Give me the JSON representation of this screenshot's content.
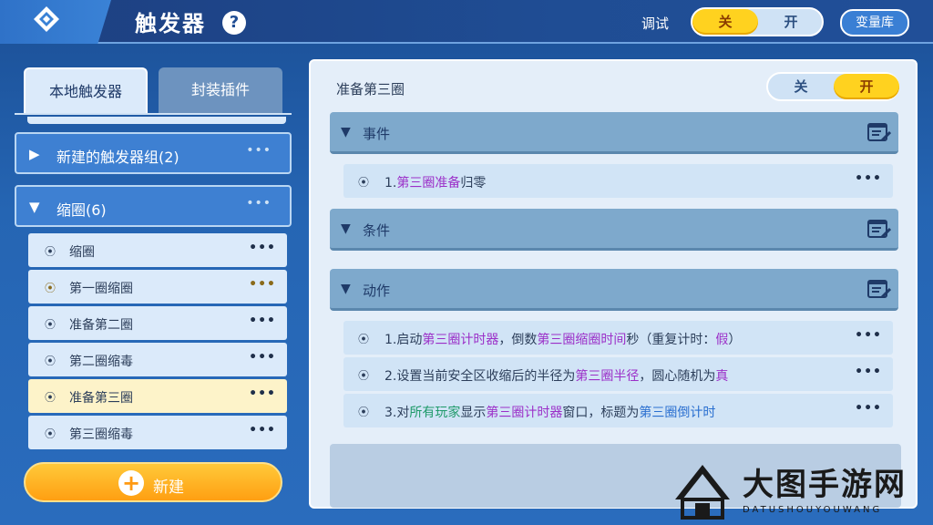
{
  "header": {
    "title": "触发器",
    "help_symbol": "?",
    "debug_label": "调试",
    "debug_toggle": {
      "off": "关",
      "on": "开",
      "selected": "off"
    },
    "var_lib_button": "变量库"
  },
  "left": {
    "tabs": [
      {
        "label": "本地触发器",
        "active": true
      },
      {
        "label": "封装插件",
        "active": false
      }
    ],
    "groups": [
      {
        "label": "新建的触发器组(2)",
        "expanded": false,
        "more": "•••"
      },
      {
        "label": "缩圈(6)",
        "expanded": true,
        "more": "•••"
      }
    ],
    "items": [
      {
        "label": "缩圈",
        "more": "•••"
      },
      {
        "label": "第一圈缩圈",
        "more": "•••"
      },
      {
        "label": "准备第二圈",
        "more": "•••"
      },
      {
        "label": "第二圈缩毒",
        "more": "•••"
      },
      {
        "label": "准备第三圈",
        "more": "•••",
        "selected": true
      },
      {
        "label": "第三圈缩毒",
        "more": "•••"
      }
    ],
    "new_button": {
      "icon": "+",
      "label": "新建"
    }
  },
  "right": {
    "trigger_title": "准备第三圈",
    "toggle": {
      "off": "关",
      "on": "开",
      "selected": "on"
    },
    "sections": [
      {
        "label": "事件"
      },
      {
        "label": "条件"
      },
      {
        "label": "动作"
      }
    ],
    "event_rows": [
      {
        "parts": [
          {
            "t": "1.",
            "c": ""
          },
          {
            "t": "第三圈准备",
            "c": "purple"
          },
          {
            "t": "归零",
            "c": ""
          }
        ],
        "more": "•••"
      }
    ],
    "action_rows": [
      {
        "parts": [
          {
            "t": "1.启动",
            "c": ""
          },
          {
            "t": "第三圈计时器",
            "c": "purple"
          },
          {
            "t": "，倒数",
            "c": ""
          },
          {
            "t": "第三圈缩圈时间",
            "c": "purple"
          },
          {
            "t": "秒（重复计时：",
            "c": ""
          },
          {
            "t": "假",
            "c": "purple"
          },
          {
            "t": "）",
            "c": ""
          }
        ],
        "more": "•••"
      },
      {
        "parts": [
          {
            "t": "2.设置当前安全区收缩后的半径为",
            "c": ""
          },
          {
            "t": "第三圈半径",
            "c": "purple"
          },
          {
            "t": "，圆心随机为",
            "c": ""
          },
          {
            "t": "真",
            "c": "purple"
          }
        ],
        "more": "•••"
      },
      {
        "parts": [
          {
            "t": "3.对",
            "c": ""
          },
          {
            "t": "所有玩家",
            "c": "green"
          },
          {
            "t": "显示",
            "c": ""
          },
          {
            "t": "第三圈计时器",
            "c": "purple"
          },
          {
            "t": "窗口，标题为",
            "c": ""
          },
          {
            "t": "第三圈倒计时",
            "c": "blue"
          }
        ],
        "more": "•••"
      }
    ]
  },
  "watermark": {
    "text": "大图手游网",
    "sub": "DATUSHOUYOUWANG"
  },
  "colors": {
    "highlight_purple": "#9b2fc8",
    "highlight_green": "#1f9a6a",
    "highlight_blue": "#2a6fd0",
    "toggle_on": "#ffd21f"
  }
}
